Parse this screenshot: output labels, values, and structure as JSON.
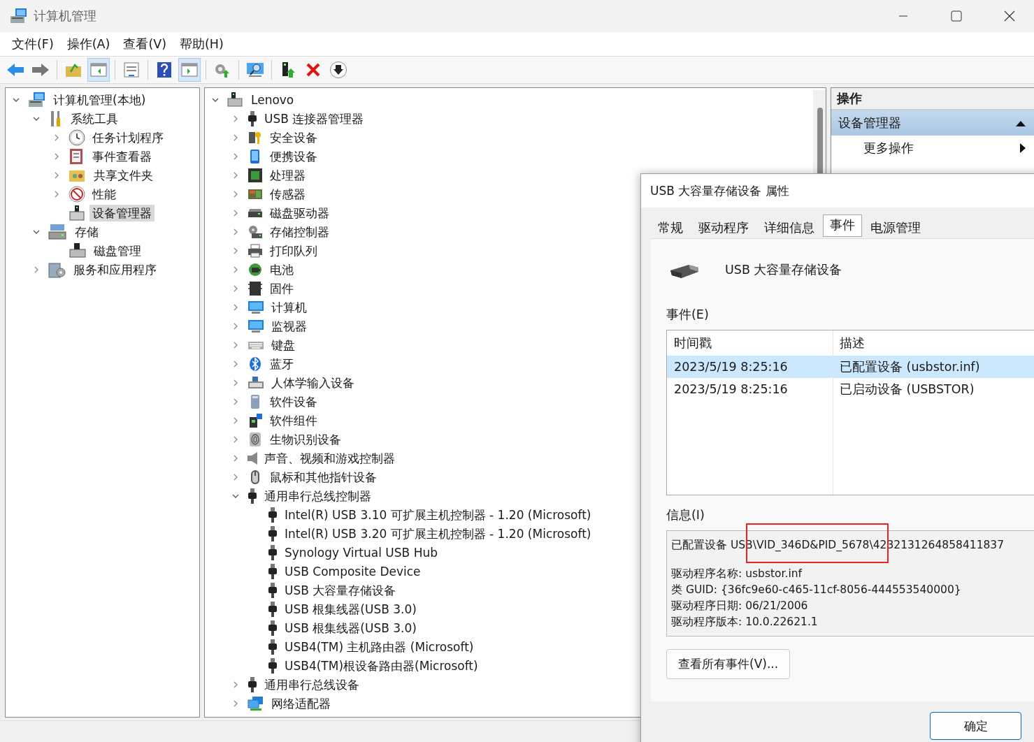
{
  "window": {
    "title": "计算机管理"
  },
  "menu": [
    {
      "label": "文件(F)"
    },
    {
      "label": "操作(A)"
    },
    {
      "label": "查看(V)"
    },
    {
      "label": "帮助(H)"
    }
  ],
  "toolbar": [
    {
      "pressed": false
    },
    {
      "pressed": false
    },
    {
      "pressed": false
    },
    {
      "pressed": true
    },
    {
      "pressed": false
    },
    {
      "pressed": false
    },
    {
      "pressed": true
    },
    {
      "pressed": false
    },
    {
      "pressed": false
    },
    {
      "pressed": false
    },
    {
      "pressed": false
    },
    {
      "pressed": false
    }
  ],
  "nav_tree": [
    {
      "label": "计算机管理(本地)",
      "expanded": true,
      "selected": false,
      "children": [
        {
          "label": "系统工具",
          "expanded": true,
          "selected": false,
          "children": [
            {
              "label": "任务计划程序",
              "expanded": false,
              "selected": false
            },
            {
              "label": "事件查看器",
              "expanded": false,
              "selected": false
            },
            {
              "label": "共享文件夹",
              "expanded": false,
              "selected": false
            },
            {
              "label": "性能",
              "expanded": false,
              "selected": false
            },
            {
              "label": "设备管理器",
              "selected": true
            }
          ]
        },
        {
          "label": "存储",
          "expanded": true,
          "selected": false,
          "children": [
            {
              "label": "磁盘管理",
              "selected": false
            }
          ]
        },
        {
          "label": "服务和应用程序",
          "expanded": false,
          "selected": false
        }
      ]
    }
  ],
  "device_tree": [
    {
      "label": "Lenovo",
      "expanded": true,
      "children": [
        {
          "label": "USB 连接器管理器",
          "expanded": false
        },
        {
          "label": "安全设备",
          "expanded": false
        },
        {
          "label": "便携设备",
          "expanded": false
        },
        {
          "label": "处理器",
          "expanded": false
        },
        {
          "label": "传感器",
          "expanded": false
        },
        {
          "label": "磁盘驱动器",
          "expanded": false
        },
        {
          "label": "存储控制器",
          "expanded": false
        },
        {
          "label": "打印队列",
          "expanded": false
        },
        {
          "label": "电池",
          "expanded": false
        },
        {
          "label": "固件",
          "expanded": false
        },
        {
          "label": "计算机",
          "expanded": false
        },
        {
          "label": "监视器",
          "expanded": false
        },
        {
          "label": "键盘",
          "expanded": false
        },
        {
          "label": "蓝牙",
          "expanded": false
        },
        {
          "label": "人体学输入设备",
          "expanded": false
        },
        {
          "label": "软件设备",
          "expanded": false
        },
        {
          "label": "软件组件",
          "expanded": false
        },
        {
          "label": "生物识别设备",
          "expanded": false
        },
        {
          "label": "声音、视频和游戏控制器",
          "expanded": false
        },
        {
          "label": "鼠标和其他指针设备",
          "expanded": false
        },
        {
          "label": "通用串行总线控制器",
          "expanded": true,
          "children": [
            {
              "label": "Intel(R) USB 3.10 可扩展主机控制器 - 1.20 (Microsoft)"
            },
            {
              "label": "Intel(R) USB 3.20 可扩展主机控制器 - 1.20 (Microsoft)"
            },
            {
              "label": "Synology Virtual USB Hub"
            },
            {
              "label": "USB Composite Device"
            },
            {
              "label": "USB 大容量存储设备"
            },
            {
              "label": "USB 根集线器(USB 3.0)"
            },
            {
              "label": "USB 根集线器(USB 3.0)"
            },
            {
              "label": "USB4(TM) 主机路由器 (Microsoft)"
            },
            {
              "label": "USB4(TM)根设备路由器(Microsoft)"
            }
          ]
        },
        {
          "label": "通用串行总线设备",
          "expanded": false
        },
        {
          "label": "网络适配器",
          "expanded": false
        }
      ]
    }
  ],
  "actions": {
    "header": "操作",
    "section": {
      "label": "设备管理器",
      "expanded": true
    },
    "items": [
      {
        "label": "更多操作"
      }
    ]
  },
  "dialog": {
    "title": "USB 大容量存储设备 属性",
    "tabs": [
      {
        "label": "常规",
        "selected": false
      },
      {
        "label": "驱动程序",
        "selected": false
      },
      {
        "label": "详细信息",
        "selected": false
      },
      {
        "label": "事件",
        "selected": true
      },
      {
        "label": "电源管理",
        "selected": false
      }
    ],
    "device_name": "USB 大容量存储设备",
    "events_label": "事件(E)",
    "events_table": {
      "columns": [
        "时间戳",
        "描述"
      ],
      "rows": [
        {
          "cells": [
            "2023/5/19 8:25:16",
            "已配置设备 (usbstor.inf)"
          ],
          "selected": true
        },
        {
          "cells": [
            "2023/5/19 8:25:16",
            "已启动设备 (USBSTOR)"
          ],
          "selected": false
        }
      ]
    },
    "info_label": "信息(I)",
    "info_lines": [
      "已配置设备 USB\\VID_346D&PID_5678\\4232131264858411837",
      "驱动程序名称: usbstor.inf",
      "类 GUID: {36fc9e60-c465-11cf-8056-444553540000}",
      "驱动程序日期: 06/21/2006",
      "驱动程序版本: 10.0.22621.1"
    ],
    "info_highlighted": true,
    "view_all_button": "查看所有事件(V)...",
    "ok_button": "确定"
  }
}
